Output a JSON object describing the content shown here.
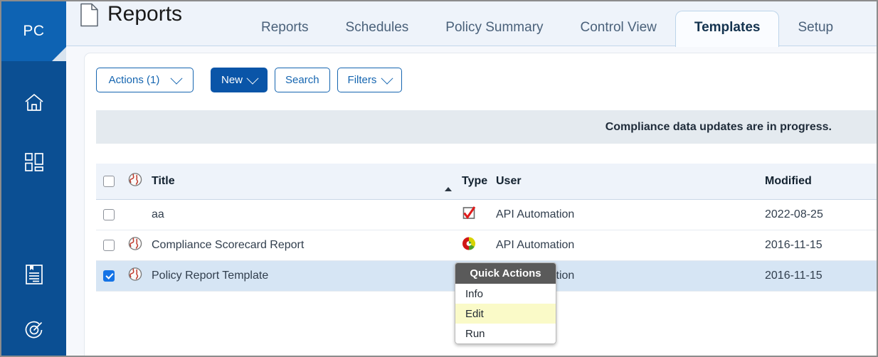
{
  "app": {
    "logo_text": "PC"
  },
  "sidebar": {
    "items": [
      {
        "name": "home-icon",
        "label": "Home"
      },
      {
        "name": "dashboard-icon",
        "label": "Dashboard"
      },
      {
        "name": "reports-icon",
        "label": "Reports"
      },
      {
        "name": "gauge-icon",
        "label": "Monitoring"
      }
    ]
  },
  "header": {
    "title": "Reports",
    "doc_icon": "document-icon",
    "tabs": [
      {
        "label": "Reports",
        "active": false
      },
      {
        "label": "Schedules",
        "active": false
      },
      {
        "label": "Policy Summary",
        "active": false
      },
      {
        "label": "Control View",
        "active": false
      },
      {
        "label": "Templates",
        "active": true
      },
      {
        "label": "Setup",
        "active": false
      }
    ]
  },
  "toolbar": {
    "actions_label": "Actions (1)",
    "new_label": "New",
    "search_label": "Search",
    "filters_label": "Filters"
  },
  "notice": {
    "message": "Compliance data updates are in progress."
  },
  "table": {
    "columns": {
      "title": "Title",
      "type": "Type",
      "user": "User",
      "modified": "Modified"
    },
    "sort": {
      "column": "Title",
      "direction": "asc"
    },
    "rows": [
      {
        "selected": false,
        "globe": false,
        "title": "aa",
        "type_icon": "checkbox-red-check-icon",
        "user": "API Automation",
        "modified": "2022-08-25"
      },
      {
        "selected": false,
        "globe": true,
        "title": "Compliance Scorecard Report",
        "type_icon": "pie-chart-icon",
        "user": "API Automation",
        "modified": "2016-11-15"
      },
      {
        "selected": true,
        "globe": true,
        "title": "Policy Report Template",
        "type_icon": "pie-chart-icon",
        "user": "API Automation",
        "modified": "2016-11-15"
      }
    ]
  },
  "quick_actions": {
    "title": "Quick Actions",
    "items": [
      {
        "label": "Info",
        "highlighted": false
      },
      {
        "label": "Edit",
        "highlighted": true
      },
      {
        "label": "Run",
        "highlighted": false
      }
    ]
  },
  "colors": {
    "rail": "#0b4f93",
    "logo": "#0e63b3",
    "primary_button": "#0a55a8",
    "link_blue": "#1565b0",
    "selected_row": "#d6e5f4",
    "notice_bg": "#e4eaef",
    "menu_header": "#5a5a5a",
    "menu_highlight": "#fafac8"
  }
}
